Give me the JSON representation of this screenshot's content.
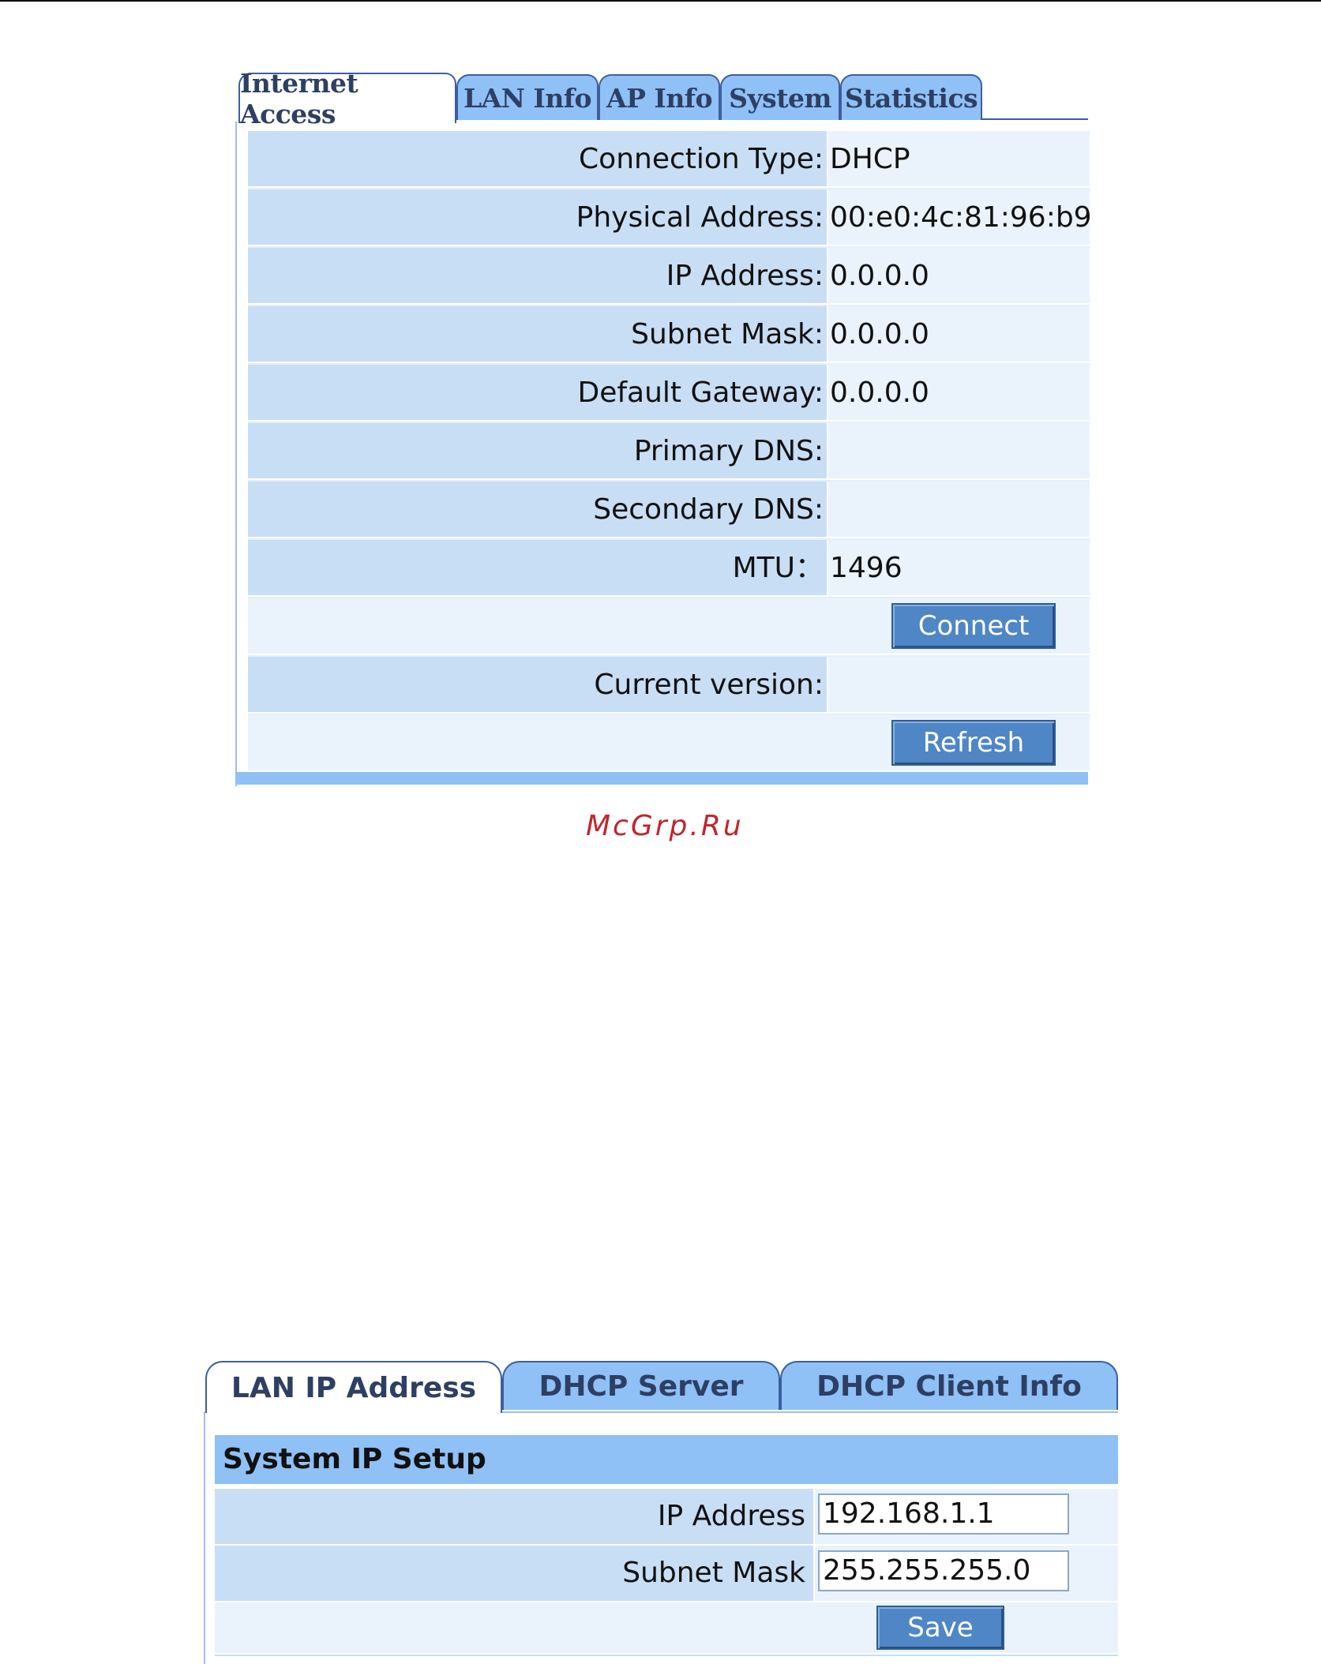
{
  "status_panel": {
    "tabs": [
      {
        "label": "Internet Access",
        "active": true
      },
      {
        "label": "LAN Info",
        "active": false
      },
      {
        "label": "AP Info",
        "active": false
      },
      {
        "label": "System",
        "active": false
      },
      {
        "label": "Statistics",
        "active": false
      }
    ],
    "rows": [
      {
        "label": "Connection Type:",
        "value": "DHCP"
      },
      {
        "label": "Physical Address:",
        "value": "00:e0:4c:81:96:b9"
      },
      {
        "label": "IP Address:",
        "value": "0.0.0.0"
      },
      {
        "label": "Subnet Mask:",
        "value": "0.0.0.0"
      },
      {
        "label": "Default Gateway:",
        "value": "0.0.0.0"
      },
      {
        "label": "Primary DNS:",
        "value": ""
      },
      {
        "label": "Secondary DNS:",
        "value": ""
      },
      {
        "label": "MTU：",
        "value": "1496"
      }
    ],
    "connect_label": "Connect",
    "current_version_label": "Current version:",
    "current_version_value": "",
    "refresh_label": "Refresh"
  },
  "watermark": "McGrp.Ru",
  "lan_panel": {
    "tabs": [
      {
        "label": "LAN IP Address",
        "active": true
      },
      {
        "label": "DHCP Server",
        "active": false
      },
      {
        "label": "DHCP Client Info",
        "active": false
      }
    ],
    "section_title": "System IP Setup",
    "fields": [
      {
        "label": "IP Address",
        "value": "192.168.1.1"
      },
      {
        "label": "Subnet Mask",
        "value": "255.255.255.0"
      }
    ],
    "save_label": "Save"
  },
  "colors": {
    "tab_blue": "#8fc0f6",
    "label_cell": "#c8def4",
    "value_cell": "#eaf3fc",
    "button_blue": "#4f86c6",
    "watermark_red": "#c0262d"
  }
}
